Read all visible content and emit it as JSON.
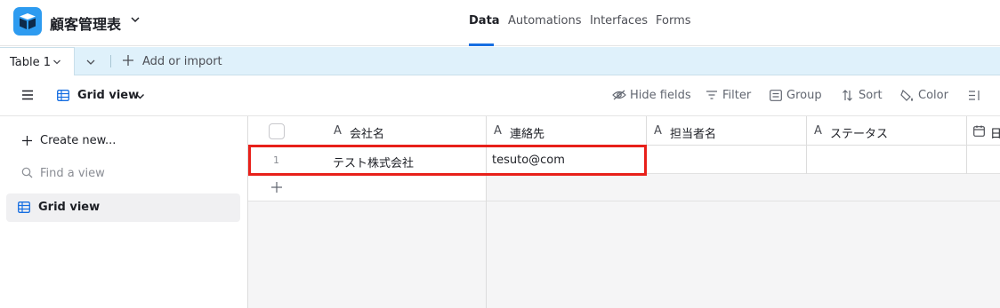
{
  "app": {
    "base_name": "顧客管理表",
    "brand_color": "#2d9bf0",
    "nav_tabs": [
      {
        "label": "Data",
        "active": true
      },
      {
        "label": "Automations",
        "active": false
      },
      {
        "label": "Interfaces",
        "active": false
      },
      {
        "label": "Forms",
        "active": false
      }
    ]
  },
  "tables": {
    "active_tab": "Table 1",
    "add_or_import": "Add or import"
  },
  "toolbar": {
    "view_name": "Grid view",
    "hide_fields": "Hide fields",
    "filter": "Filter",
    "group": "Group",
    "sort": "Sort",
    "color": "Color"
  },
  "sidebar": {
    "create_new": "Create new...",
    "find_view_placeholder": "Find a view",
    "views": [
      {
        "label": "Grid view",
        "icon": "grid-icon",
        "selected": true
      }
    ]
  },
  "grid": {
    "columns": [
      {
        "label": "会社名",
        "icon": "text-field-icon"
      },
      {
        "label": "連絡先",
        "icon": "text-field-icon"
      },
      {
        "label": "担当者名",
        "icon": "text-field-icon"
      },
      {
        "label": "ステータス",
        "icon": "text-field-icon"
      },
      {
        "label": "日",
        "icon": "date-field-icon"
      }
    ],
    "rows": [
      {
        "num": "1",
        "cells": [
          "テスト株式会社",
          "tesuto@com",
          "",
          ""
        ]
      }
    ],
    "highlight_color": "#e8201a"
  }
}
